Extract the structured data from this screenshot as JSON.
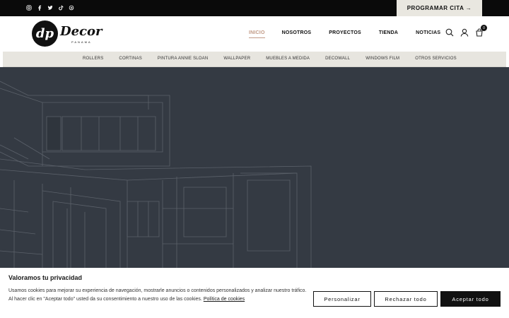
{
  "topbar": {
    "social": [
      "instagram-icon",
      "facebook-icon",
      "twitter-icon",
      "tiktok-icon",
      "threads-icon"
    ],
    "cta_label": "PROGRAMAR CITA →"
  },
  "header": {
    "logo_mark": "dp",
    "logo_word": "Decor",
    "logo_sub": "PANAMA",
    "nav": [
      "INICIO",
      "NOSOTROS",
      "PROYECTOS",
      "TIENDA",
      "NOTICIAS"
    ],
    "active_nav": "INICIO",
    "cart_count": "0",
    "icons": [
      "search-icon",
      "user-icon",
      "cart-icon"
    ]
  },
  "categories": [
    "ROLLERS",
    "CORTINAS",
    "PINTURA ANNIE SLOAN",
    "WALLPAPER",
    "MUEBLES A MEDIDA",
    "DECOWALL",
    "WINDOWS FILM",
    "OTROS SERVICIOS"
  ],
  "cookie": {
    "title": "Valoramos tu privacidad",
    "text": "Usamos cookies para mejorar su experiencia de navegación, mostrarle anuncios o contenidos personalizados y analizar nuestro tráfico. Al hacer clic en \"Aceptar todo\" usted da su consentimiento a nuestro uso de las cookies.",
    "link": "Política de cookies",
    "buttons": {
      "personalizar": "Personalizar",
      "rechazar": "Rechazar todo",
      "aceptar": "Aceptar todo"
    }
  },
  "colors": {
    "topbar_bg": "#0a0a0a",
    "accent": "#c29a86",
    "hero_bg": "#343a43",
    "catbar_bg": "#e7e5df"
  }
}
